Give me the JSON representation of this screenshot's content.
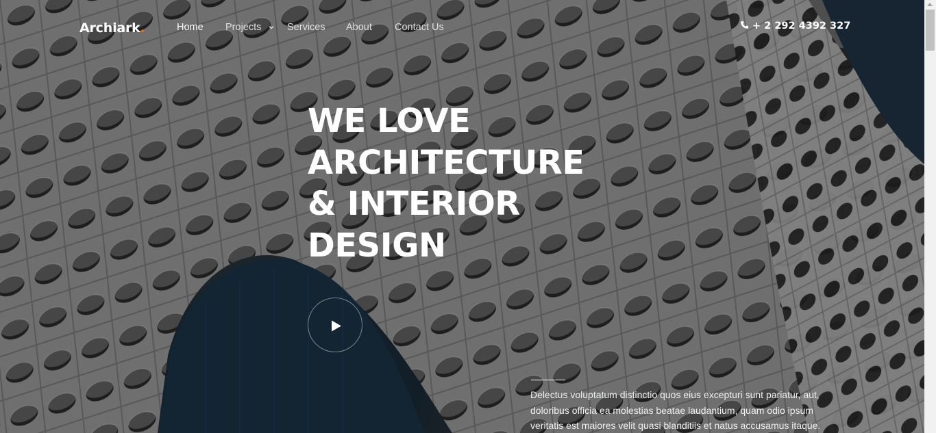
{
  "brand": {
    "name": "Archiark",
    "dot": ".",
    "accent_color": "#f26b1d"
  },
  "nav": {
    "items": [
      {
        "label": "Home",
        "active": true
      },
      {
        "label": "Projects",
        "has_dropdown": true
      },
      {
        "label": "Services"
      },
      {
        "label": "About"
      },
      {
        "label": "Contact Us"
      }
    ]
  },
  "contact": {
    "phone_icon": "phone-icon",
    "phone": "+ 2 292 4392 327"
  },
  "hero": {
    "headline_lines": [
      "WE LOVE",
      "ARCHITECTURE",
      "& INTERIOR",
      "DESIGN"
    ],
    "play_icon": "play-icon",
    "description": "Delectus voluptatum distinctio quos eius excepturi sunt pariatur, aut, doloribus officia ea molestias beatae laudantium, quam odio ipsum veritatis est maiores velit quasi blanditiis et natus accusamus itaque."
  }
}
